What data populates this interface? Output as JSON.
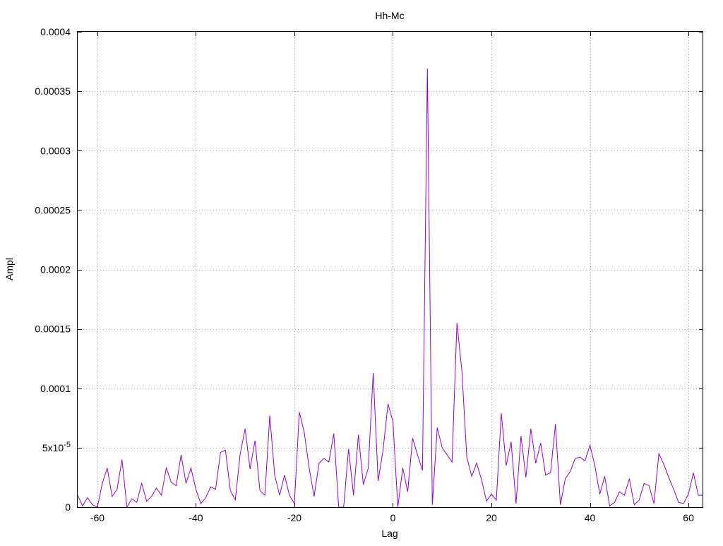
{
  "chart_data": {
    "type": "line",
    "title": "Hh-Mc",
    "xlabel": "Lag",
    "ylabel": "Ampl",
    "xlim": [
      -64,
      63
    ],
    "ylim": [
      0,
      0.0004
    ],
    "grid": true,
    "x_ticks": [
      -60,
      -40,
      -20,
      0,
      20,
      40,
      60
    ],
    "x_tick_labels": [
      "-60",
      "-40",
      "-20",
      "0",
      "20",
      "40",
      "60"
    ],
    "y_ticks": [
      0,
      5e-05,
      0.0001,
      0.00015,
      0.0002,
      0.00025,
      0.0003,
      0.00035,
      0.0004
    ],
    "y_tick_labels": [
      "0",
      "5x10-5",
      "0.0001",
      "0.00015",
      "0.0002",
      "0.00025",
      "0.0003",
      "0.00035",
      "0.0004"
    ],
    "series": [
      {
        "color": "#9400d3",
        "x": [
          -64,
          -63,
          -62,
          -61,
          -60,
          -59,
          -58,
          -57,
          -56,
          -55,
          -54,
          -53,
          -52,
          -51,
          -50,
          -49,
          -48,
          -47,
          -46,
          -45,
          -44,
          -43,
          -42,
          -41,
          -40,
          -39,
          -38,
          -37,
          -36,
          -35,
          -34,
          -33,
          -32,
          -31,
          -30,
          -29,
          -28,
          -27,
          -26,
          -25,
          -24,
          -23,
          -22,
          -21,
          -20,
          -19,
          -18,
          -17,
          -16,
          -15,
          -14,
          -13,
          -12,
          -11,
          -10,
          -9,
          -8,
          -7,
          -6,
          -5,
          -4,
          -3,
          -2,
          -1,
          0,
          1,
          2,
          3,
          4,
          5,
          6,
          7,
          8,
          9,
          10,
          11,
          12,
          13,
          14,
          15,
          16,
          17,
          18,
          19,
          20,
          21,
          22,
          23,
          24,
          25,
          26,
          27,
          28,
          29,
          30,
          31,
          32,
          33,
          34,
          35,
          36,
          37,
          38,
          39,
          40,
          41,
          42,
          43,
          44,
          45,
          46,
          47,
          48,
          49,
          50,
          51,
          52,
          53,
          54,
          55,
          56,
          57,
          58,
          59,
          60,
          61,
          62,
          63
        ],
        "y": [
          1e-05,
          1e-06,
          8e-06,
          2e-06,
          0,
          2e-05,
          3.3e-05,
          9e-06,
          1.5e-05,
          4e-05,
          0,
          7e-06,
          4e-06,
          2e-05,
          5e-06,
          9e-06,
          1.6e-05,
          1e-05,
          3.3e-05,
          2.1e-05,
          1.8e-05,
          4.4e-05,
          2e-05,
          3.3e-05,
          1.5e-05,
          3e-06,
          8e-06,
          1.7e-05,
          1.5e-05,
          4.6e-05,
          4.8e-05,
          1.4e-05,
          6e-06,
          4.5e-05,
          6.6e-05,
          3.2e-05,
          5.6e-05,
          1.4e-05,
          1e-05,
          7.7e-05,
          2.7e-05,
          1e-05,
          2.7e-05,
          1e-05,
          3e-06,
          8e-05,
          6.3e-05,
          3.3e-05,
          9e-06,
          3.7e-05,
          4.1e-05,
          3.8e-05,
          6.2e-05,
          0,
          0,
          4.9e-05,
          1e-05,
          6.1e-05,
          1.9e-05,
          3.3e-05,
          0.000113,
          2.2e-05,
          4.8e-05,
          8.7e-05,
          7.2e-05,
          0,
          3.3e-05,
          1.3e-05,
          5.8e-05,
          4.4e-05,
          3.1e-05,
          0.000369,
          2e-06,
          6.7e-05,
          5e-05,
          4.4e-05,
          3.8e-05,
          0.000155,
          0.000115,
          4.2e-05,
          2.6e-05,
          3.7e-05,
          2.3e-05,
          5e-06,
          1.1e-05,
          6e-06,
          7.9e-05,
          3.5e-05,
          5.5e-05,
          3e-06,
          6e-05,
          2.5e-05,
          6.6e-05,
          3.7e-05,
          5.4e-05,
          2.7e-05,
          2.9e-05,
          7e-05,
          2e-06,
          2.4e-05,
          3e-05,
          4.1e-05,
          4.2e-05,
          3.9e-05,
          5.2e-05,
          3.5e-05,
          1.1e-05,
          2.6e-05,
          1e-06,
          4e-06,
          1.3e-05,
          1e-05,
          2.4e-05,
          2e-06,
          6e-06,
          2e-05,
          1.8e-05,
          3e-06,
          4.5e-05,
          3.6e-05,
          2.5e-05,
          1.5e-05,
          4e-06,
          3e-06,
          1.1e-05,
          2.9e-05,
          1e-05,
          1e-05
        ]
      }
    ]
  }
}
